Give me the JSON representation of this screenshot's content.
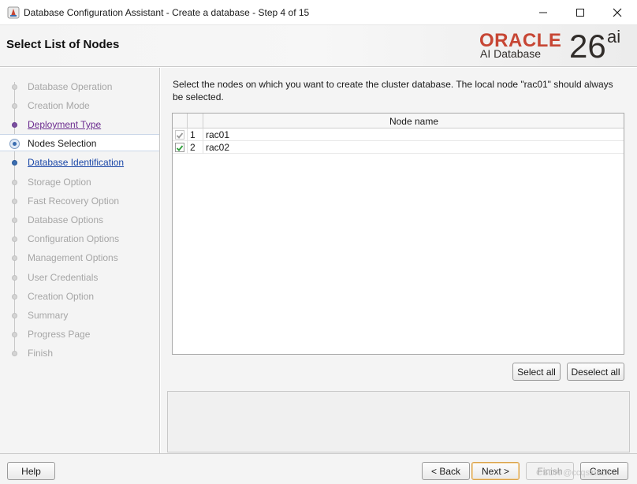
{
  "window": {
    "title": "Database Configuration Assistant - Create a database - Step 4 of 15",
    "minimize_glyph": "—",
    "maximize_glyph": "☐",
    "close_glyph": "✕"
  },
  "header": {
    "page_title": "Select List of Nodes",
    "logo_word": "ORACLE",
    "logo_product": "AI Database",
    "logo_version": "26",
    "logo_version_suffix": "ai"
  },
  "nav": {
    "items": [
      {
        "label": "Database Operation",
        "state": "disabled"
      },
      {
        "label": "Creation Mode",
        "state": "disabled"
      },
      {
        "label": "Deployment Type",
        "state": "visited"
      },
      {
        "label": "Nodes Selection",
        "state": "current"
      },
      {
        "label": "Database Identification",
        "state": "link"
      },
      {
        "label": "Storage Option",
        "state": "disabled"
      },
      {
        "label": "Fast Recovery Option",
        "state": "disabled"
      },
      {
        "label": "Database Options",
        "state": "disabled"
      },
      {
        "label": "Configuration Options",
        "state": "disabled"
      },
      {
        "label": "Management Options",
        "state": "disabled"
      },
      {
        "label": "User Credentials",
        "state": "disabled"
      },
      {
        "label": "Creation Option",
        "state": "disabled"
      },
      {
        "label": "Summary",
        "state": "disabled"
      },
      {
        "label": "Progress Page",
        "state": "disabled"
      },
      {
        "label": "Finish",
        "state": "disabled"
      }
    ]
  },
  "main": {
    "instruction": "Select the nodes on which you want to create the cluster database. The local node \"rac01\" should always be selected.",
    "table": {
      "column_header": "Node name",
      "rows": [
        {
          "index": "1",
          "name": "rac01",
          "checked": true,
          "enabled": false
        },
        {
          "index": "2",
          "name": "rac02",
          "checked": true,
          "enabled": true
        }
      ]
    },
    "select_all_label": "Select all",
    "deselect_all_label": "Deselect all"
  },
  "footer": {
    "help_label": "Help",
    "back_label": "< Back",
    "next_label": "Next >",
    "finish_label": "Finish",
    "cancel_label": "Cancel",
    "watermark": "CSDN @ccqsztech"
  },
  "colors": {
    "oracle_red": "#c74634",
    "link_blue": "#1c48a8",
    "visited_purple": "#6b2c8f",
    "check_green": "#2e9e3a"
  }
}
